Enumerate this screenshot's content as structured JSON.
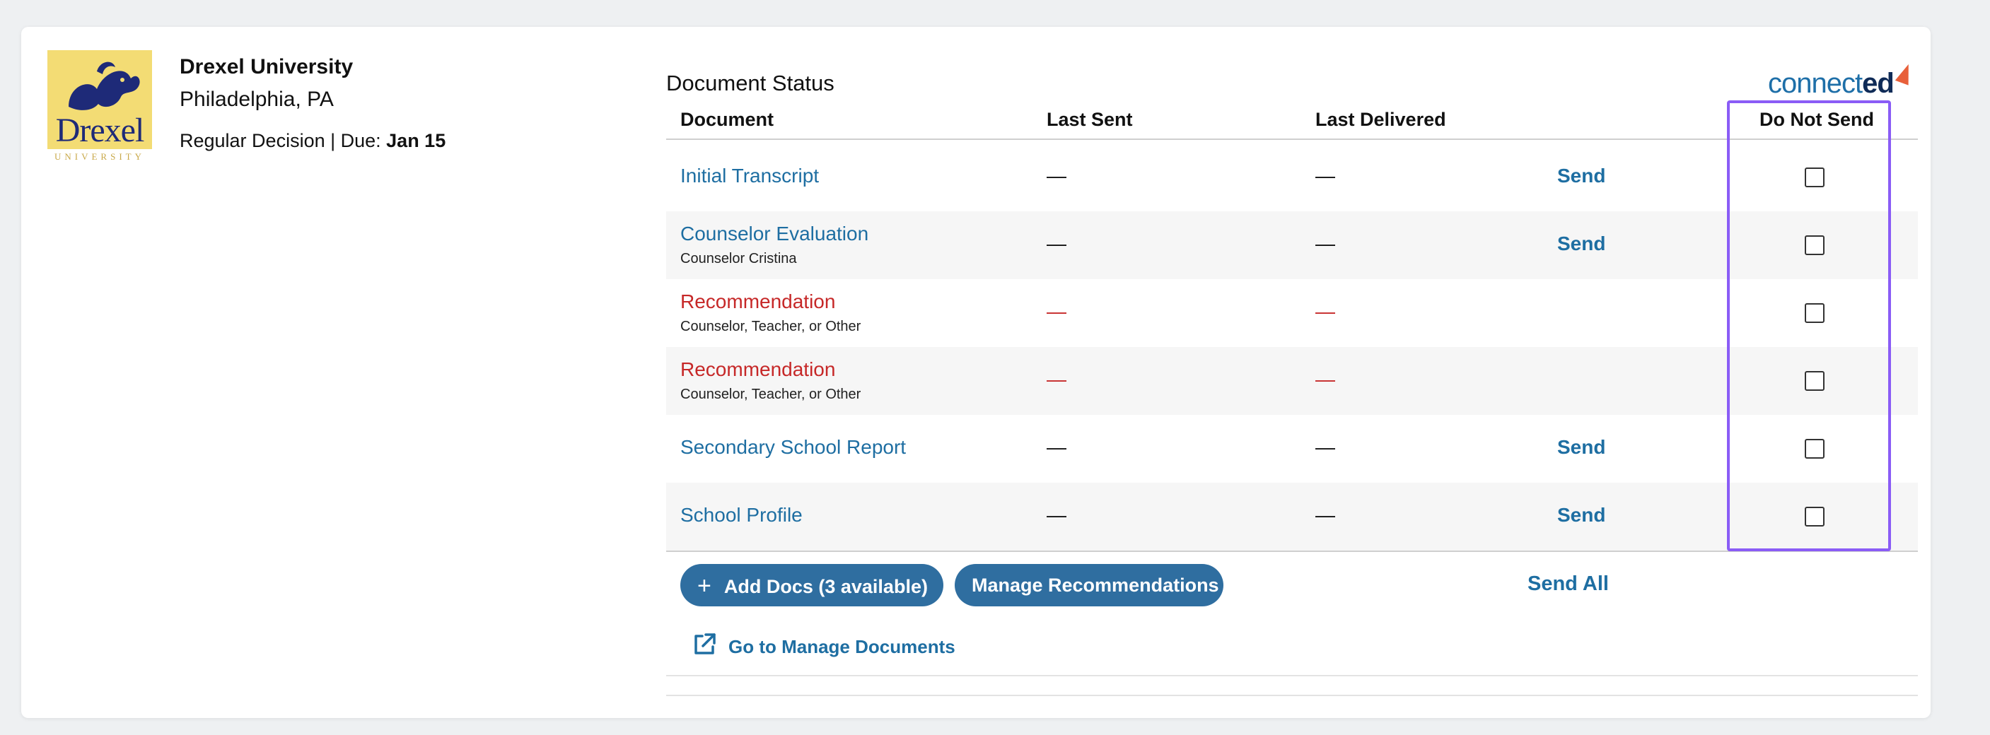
{
  "college": {
    "name": "Drexel University",
    "location": "Philadelphia, PA",
    "decision_label": "Regular Decision | Due: ",
    "due_date": "Jan 15",
    "logo_word": "Drexel",
    "logo_sub": "UNIVERSITY"
  },
  "panel": {
    "title": "Document Status",
    "brand_logo_part1": "connect",
    "brand_logo_part2": "ed"
  },
  "table": {
    "headers": {
      "document": "Document",
      "last_sent": "Last Sent",
      "last_delivered": "Last Delivered",
      "do_not_send": "Do Not Send"
    },
    "rows": [
      {
        "name": "Initial Transcript",
        "sub": "",
        "last_sent": "—",
        "last_delivered": "—",
        "action": "Send",
        "do_not_send": false,
        "status": "link"
      },
      {
        "name": "Counselor Evaluation",
        "sub": "Counselor Cristina",
        "last_sent": "—",
        "last_delivered": "—",
        "action": "Send",
        "do_not_send": false,
        "status": "link"
      },
      {
        "name": "Recommendation",
        "sub": "Counselor, Teacher, or Other",
        "last_sent": "—",
        "last_delivered": "—",
        "action": "",
        "do_not_send": false,
        "status": "missing"
      },
      {
        "name": "Recommendation",
        "sub": "Counselor, Teacher, or Other",
        "last_sent": "—",
        "last_delivered": "—",
        "action": "",
        "do_not_send": false,
        "status": "missing"
      },
      {
        "name": "Secondary School Report",
        "sub": "",
        "last_sent": "—",
        "last_delivered": "—",
        "action": "Send",
        "do_not_send": false,
        "status": "link"
      },
      {
        "name": "School Profile",
        "sub": "",
        "last_sent": "—",
        "last_delivered": "—",
        "action": "Send",
        "do_not_send": false,
        "status": "link"
      }
    ]
  },
  "actions": {
    "add_docs_label": "Add Docs (3 available)",
    "add_docs_icon": "+",
    "manage_recs_label": "Manage Recommendations",
    "send_all_label": "Send All",
    "goto_label": "Go to Manage Documents"
  },
  "colors": {
    "link": "#1e6ea2",
    "missing": "#c62828",
    "pill_bg": "#2f6ea0",
    "highlight": "#8a5cf6"
  }
}
